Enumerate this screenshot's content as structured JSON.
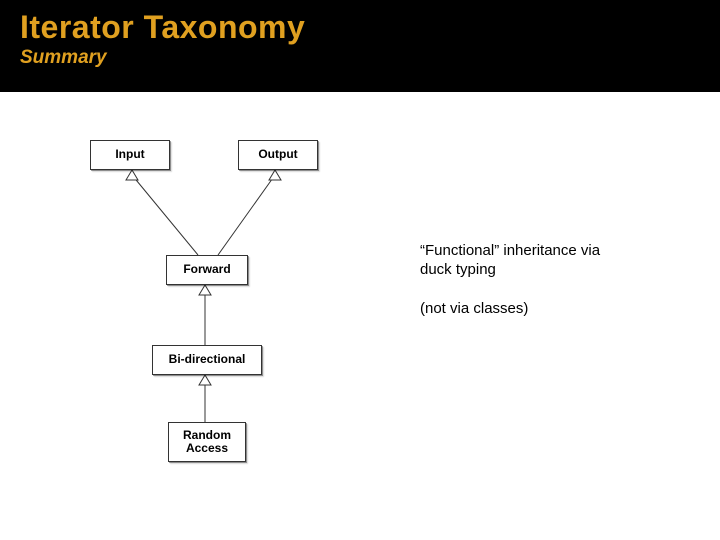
{
  "header": {
    "title": "Iterator Taxonomy",
    "subtitle": "Summary"
  },
  "boxes": {
    "input": "Input",
    "output": "Output",
    "forward": "Forward",
    "bidir": "Bi-directional",
    "random": "Random\nAccess"
  },
  "notes": {
    "line1": "“Functional” inheritance via duck typing",
    "line2": "(not via classes)"
  }
}
